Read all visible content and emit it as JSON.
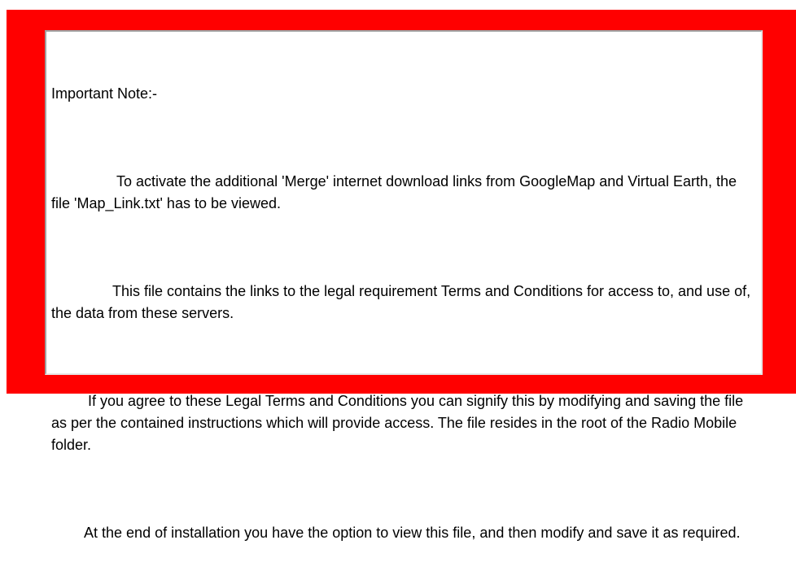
{
  "colors": {
    "frame": "#ff0000",
    "box_background": "#ffffff",
    "text": "#000000"
  },
  "note": {
    "title": "Important Note:-",
    "paragraphs": [
      "                To activate the additional 'Merge' internet download links from GoogleMap and Virtual Earth, the file 'Map_Link.txt' has to be viewed.",
      "               This file contains the links to the legal requirement Terms and Conditions for access to, and use of, the data from these servers.",
      "         If you agree to these Legal Terms and Conditions you can signify this by modifying and saving the file as per the contained instructions which will provide access. The file resides in the root of the Radio Mobile folder.",
      "        At the end of installation you have the option to view this file, and then modify and save it as required."
    ]
  }
}
